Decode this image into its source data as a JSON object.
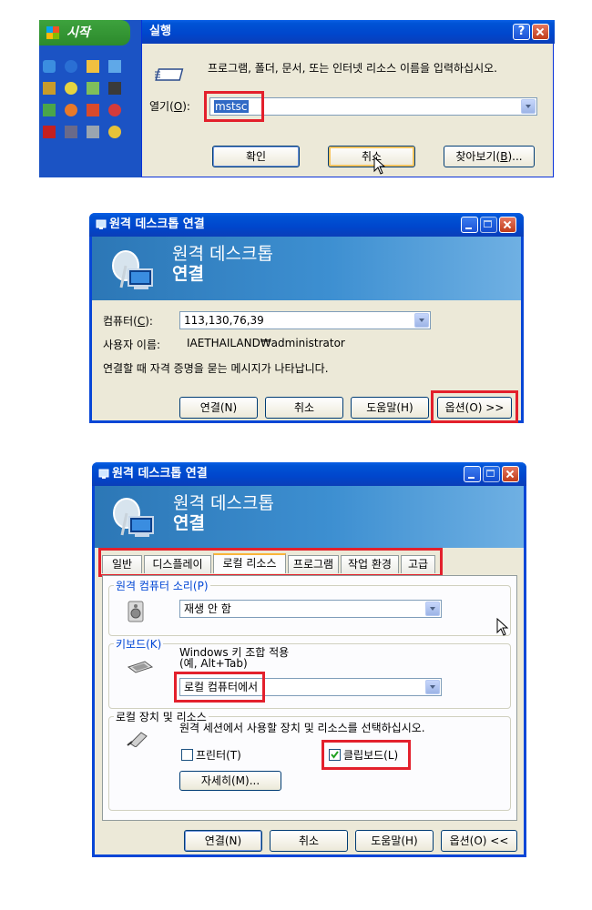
{
  "run_dialog": {
    "start_label": "시작",
    "title": "실행",
    "help_glyph": "?",
    "description": "프로그램, 폴더, 문서, 또는 인터넷 리소스 이름을 입력하십시오.",
    "open_label_prefix": "열기(",
    "open_label_key": "O",
    "open_label_suffix": "):",
    "open_value": "mstsc",
    "ok_label": "확인",
    "cancel_label": "취소",
    "browse_label_prefix": "찾아보기(",
    "browse_label_key": "B",
    "browse_label_suffix": ")..."
  },
  "rdp1": {
    "title": "원격 데스크톱 연결",
    "banner_line1": "원격 데스크톱",
    "banner_line2": "연결",
    "computer_label_prefix": "컴퓨터(",
    "computer_label_key": "C",
    "computer_label_suffix": "):",
    "computer_value": "113,130,76,39",
    "user_label": "사용자 이름:",
    "user_value": "IAETHAILAND₩administrator",
    "info_text": "연결할 때 자격 증명을 묻는 메시지가 나타납니다.",
    "connect_label": "연결(N)",
    "cancel_label": "취소",
    "help_label": "도움말(H)",
    "options_label": "옵션(O) >>"
  },
  "rdp2": {
    "title": "원격 데스크톱 연결",
    "banner_line1": "원격 데스크톱",
    "banner_line2": "연결",
    "tabs": [
      "일반",
      "디스플레이",
      "로컬 리소스",
      "프로그램",
      "작업 환경",
      "고급"
    ],
    "active_tab": "로컬 리소스",
    "sound_group_label": "원격 컴퓨터 소리(P)",
    "sound_value": "재생 안 함",
    "keyboard_group_label": "키보드(K)",
    "keyboard_desc_line1": "Windows 키 조합 적용",
    "keyboard_desc_line2": "(예, Alt+Tab)",
    "keyboard_value": "로컬 컴퓨터에서",
    "devices_group_label": "로컬 장치 및 리소스",
    "devices_desc": "원격 세션에서 사용할 장치 및 리소스를 선택하십시오.",
    "printer_label": "프린터(T)",
    "printer_checked": false,
    "clipboard_label": "클립보드(L)",
    "clipboard_checked": true,
    "details_label": "자세히(M)...",
    "connect_label": "연결(N)",
    "cancel_label": "취소",
    "help_label": "도움말(H)",
    "options_label": "옵션(O) <<"
  },
  "colors": {
    "highlight_red": "#e3202c",
    "xp_blue": "#0053d5",
    "dialog_bg": "#ece9d8",
    "tab_bg": "#fcfcfe"
  }
}
